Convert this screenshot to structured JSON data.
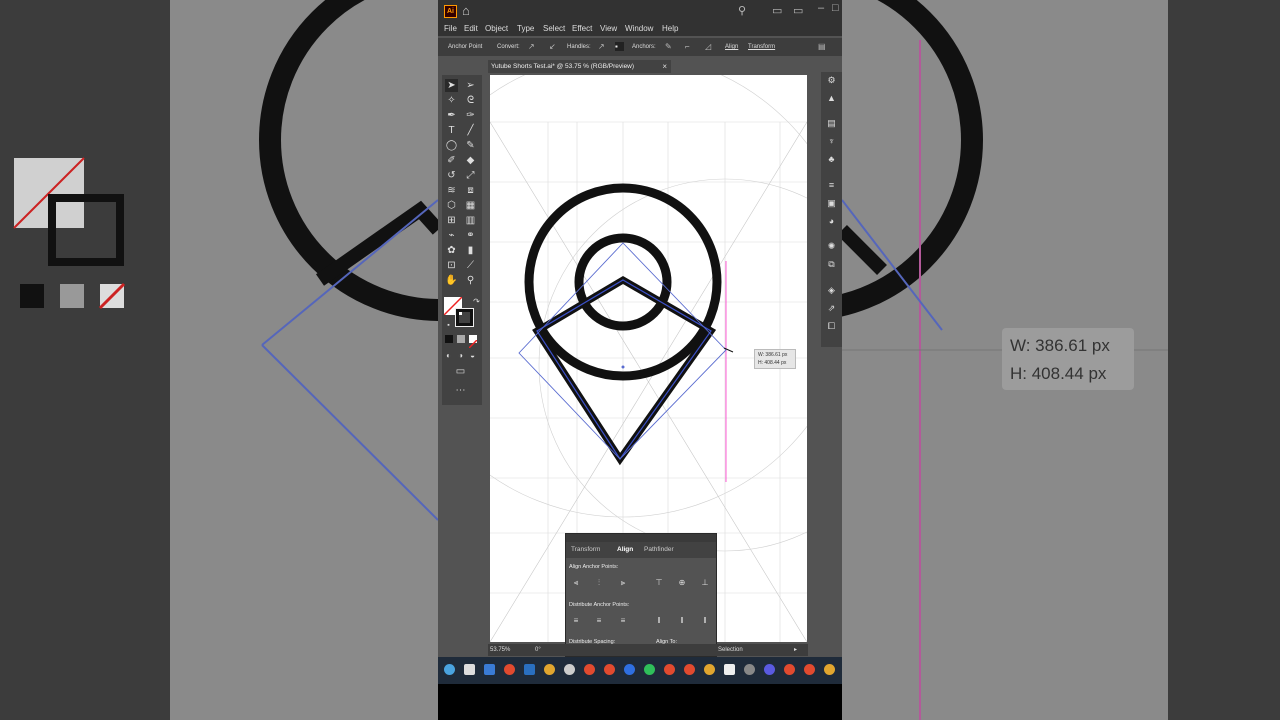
{
  "app": {
    "logo": "Ai",
    "menus": [
      "File",
      "Edit",
      "Object",
      "Type",
      "Select",
      "Effect",
      "View",
      "Window",
      "Help"
    ]
  },
  "control_bar": {
    "anchor_point": "Anchor Point",
    "convert": "Convert:",
    "handles": "Handles:",
    "anchors": "Anchors:",
    "align": "Align",
    "transform": "Transform"
  },
  "document_tab": {
    "title": "Yutube Shorts Test.ai* @ 53.75 % (RGB/Preview)",
    "close": "×"
  },
  "align_panel": {
    "tabs": [
      "Transform",
      "Align",
      "Pathfinder"
    ],
    "align_anchor_points": "Align Anchor Points:",
    "distribute_anchor_points": "Distribute Anchor Points:",
    "distribute_spacing": "Distribute Spacing:",
    "align_to": "Align To:"
  },
  "readout": {
    "width": "W: 386.61 px",
    "height": "H: 408.44 px"
  },
  "status": {
    "zoom": "53.75%",
    "rotation": "0°",
    "mode": "Selection"
  },
  "background": {
    "width": "W: 386.61 px",
    "height": "H: 408.44 px"
  },
  "colors": {
    "ui_dark": "#323232",
    "ui_mid": "#535353",
    "path_black": "#111111",
    "selection_blue": "#4a5fc4",
    "guide_magenta": "#ff00cc",
    "illustrator_orange": "#ff9a00"
  }
}
